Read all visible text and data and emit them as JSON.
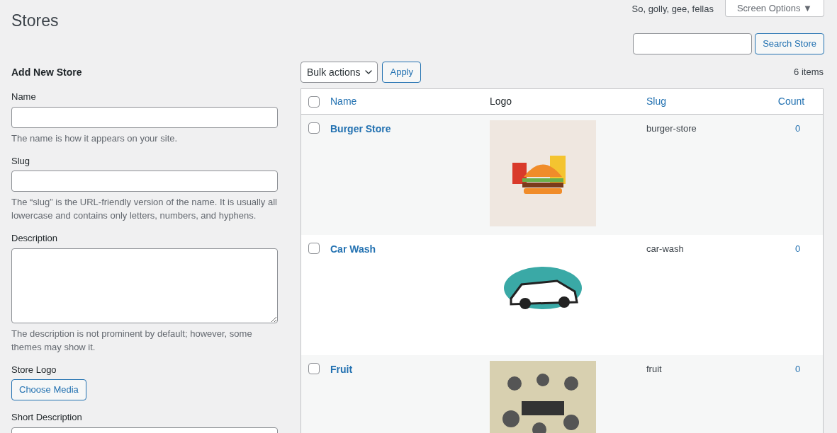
{
  "top_bar": {
    "greeting": "So, golly, gee, fellas",
    "screen_options": "Screen Options ▼"
  },
  "title": "Stores",
  "search": {
    "button": "Search Store"
  },
  "form": {
    "heading": "Add New Store",
    "fields": [
      {
        "kind": "input",
        "label": "Name",
        "help": "The name is how it appears on your site."
      },
      {
        "kind": "input",
        "label": "Slug",
        "help": "The “slug” is the URL-friendly version of the name. It is usually all lowercase and contains only letters, numbers, and hyphens."
      },
      {
        "kind": "textarea",
        "label": "Description",
        "help": "The description is not prominent by default; however, some themes may show it."
      },
      {
        "kind": "media",
        "label": "Store Logo",
        "button": "Choose Media"
      },
      {
        "kind": "textarea",
        "label": "Short Description"
      }
    ]
  },
  "toolbar": {
    "bulk_actions": "Bulk actions",
    "apply": "Apply",
    "count": "6 items"
  },
  "table": {
    "select_all_checked": false,
    "columns": [
      "Name",
      "Logo",
      "Slug",
      "Count"
    ],
    "rows": [
      {
        "name": "Burger Store",
        "slug": "burger-store",
        "count": "0",
        "checked": false
      },
      {
        "name": "Car Wash",
        "slug": "car-wash",
        "count": "0",
        "checked": false
      },
      {
        "name": "Fruit",
        "slug": "fruit",
        "count": "0",
        "checked": false
      }
    ]
  }
}
